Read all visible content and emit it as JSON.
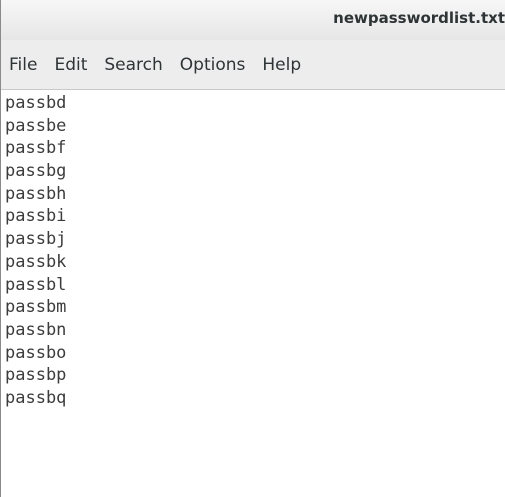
{
  "window": {
    "title": "newpasswordlist.txt"
  },
  "menu": {
    "items": [
      {
        "label": "File"
      },
      {
        "label": "Edit"
      },
      {
        "label": "Search"
      },
      {
        "label": "Options"
      },
      {
        "label": "Help"
      }
    ]
  },
  "editor": {
    "lines": [
      "passbd",
      "passbe",
      "passbf",
      "passbg",
      "passbh",
      "passbi",
      "passbj",
      "passbk",
      "passbl",
      "passbm",
      "passbn",
      "passbo",
      "passbp",
      "passbq"
    ]
  }
}
